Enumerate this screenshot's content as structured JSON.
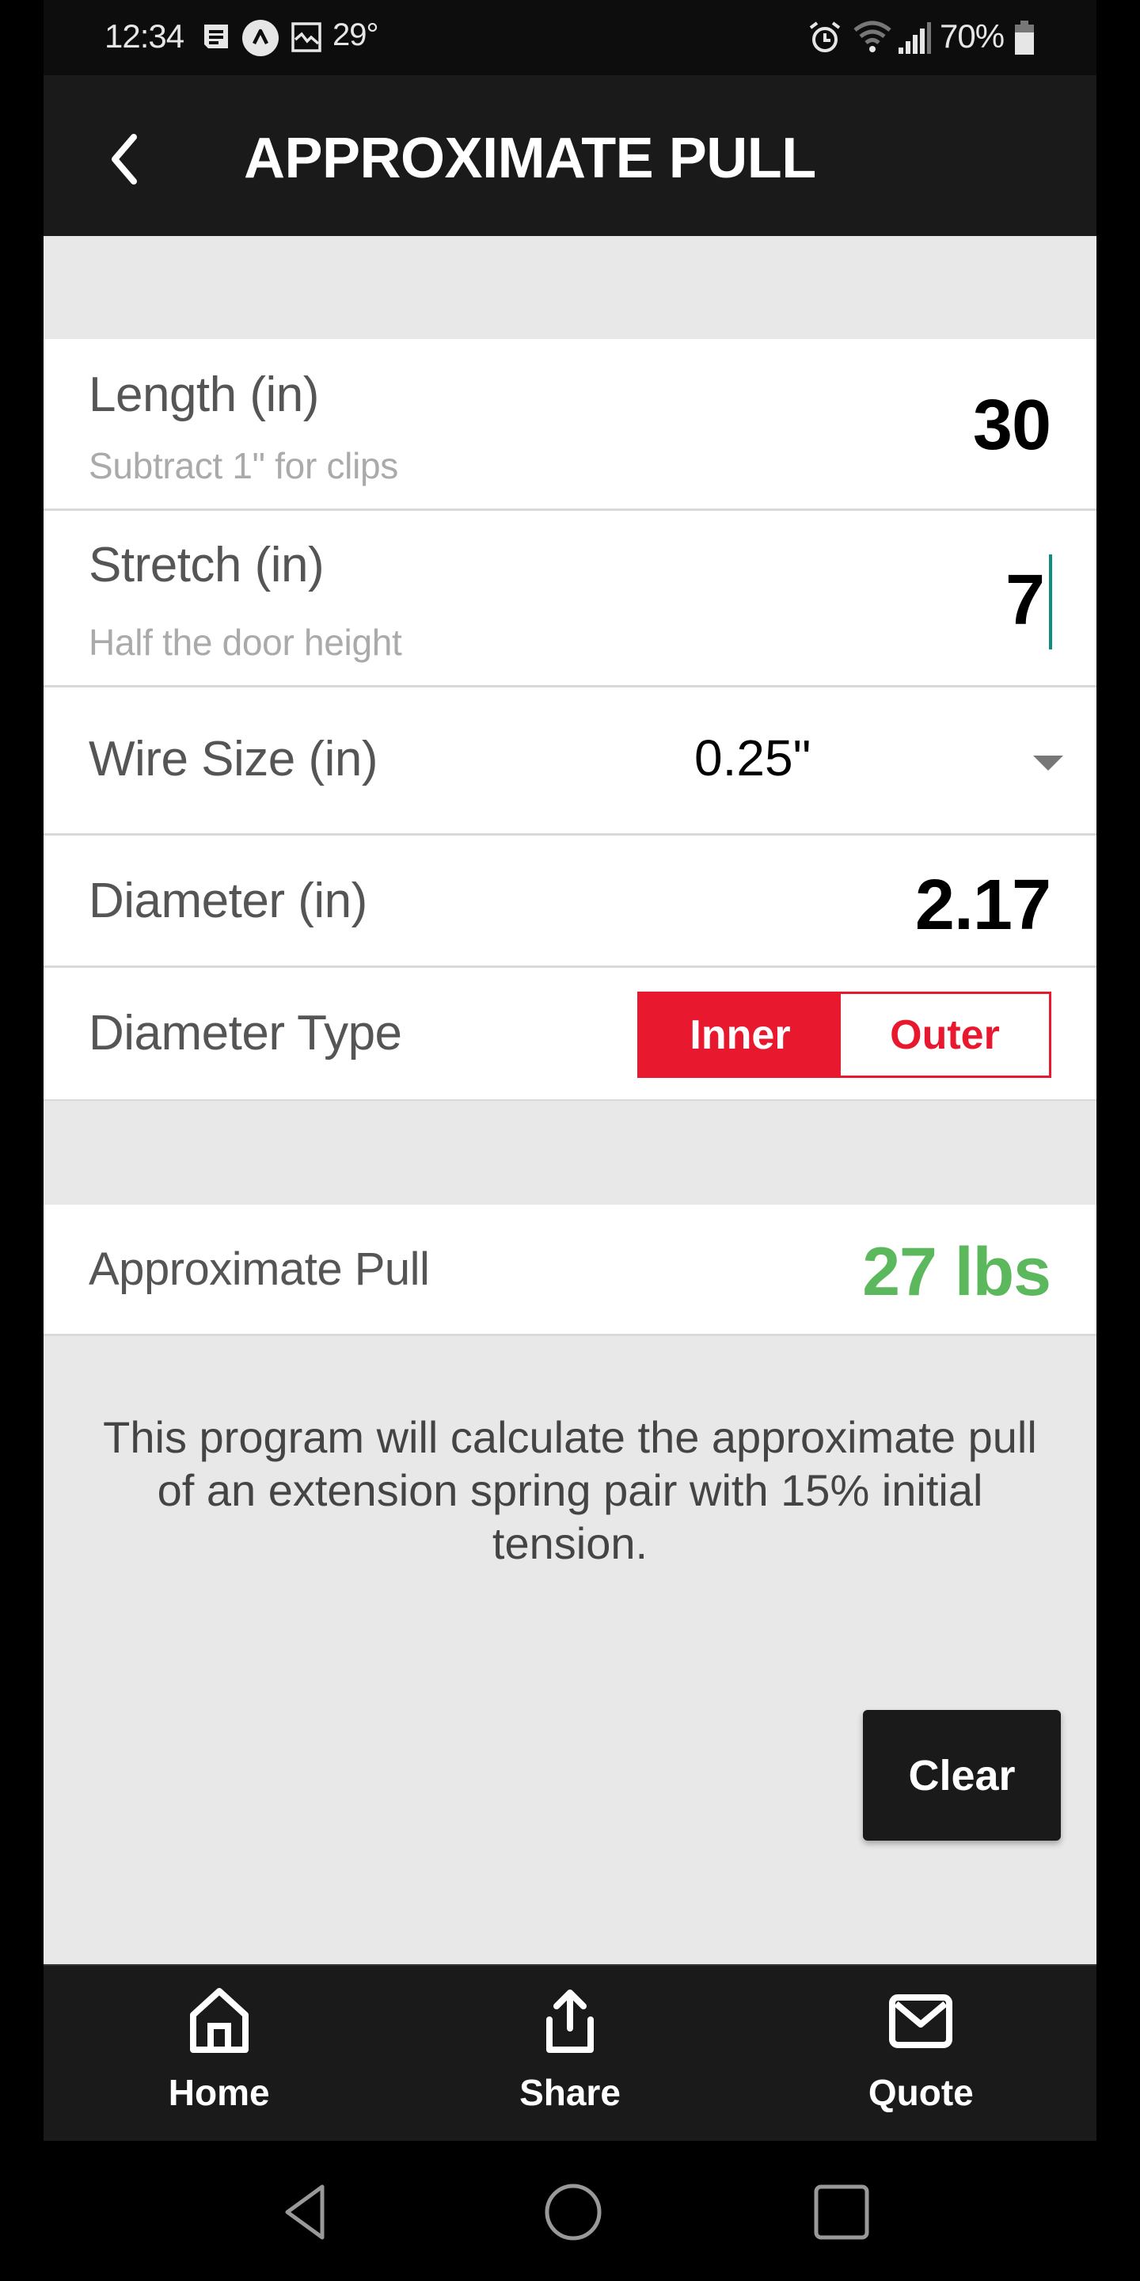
{
  "status_bar": {
    "time": "12:34",
    "temperature": "29°",
    "battery_percent": "70%",
    "left_icons": [
      "message-icon",
      "navigation-app-icon",
      "gallery-icon"
    ],
    "right_icons": [
      "alarm-icon",
      "wifi-icon",
      "signal-icon",
      "battery-icon"
    ]
  },
  "header": {
    "title": "APPROXIMATE PULL",
    "back_icon": "chevron-left-icon"
  },
  "form": {
    "length": {
      "label": "Length (in)",
      "hint": "Subtract 1\" for clips",
      "value": "30"
    },
    "stretch": {
      "label": "Stretch (in)",
      "hint": "Half the door height",
      "value": "7"
    },
    "wire_size": {
      "label": "Wire Size (in)",
      "selected": "0.25\""
    },
    "diameter": {
      "label": "Diameter (in)",
      "value": "2.17"
    },
    "diameter_type": {
      "label": "Diameter Type",
      "options": [
        {
          "label": "Inner",
          "selected": true
        },
        {
          "label": "Outer",
          "selected": false
        }
      ]
    }
  },
  "result": {
    "label": "Approximate Pull",
    "value": "27 lbs",
    "color": "#5cb85c"
  },
  "description": "This program will calculate the approximate pull of an extension spring pair with 15% initial tension.",
  "clear_button": "Clear",
  "bottom_nav": [
    {
      "label": "Home",
      "icon": "home-icon"
    },
    {
      "label": "Share",
      "icon": "share-icon"
    },
    {
      "label": "Quote",
      "icon": "mail-icon"
    }
  ],
  "accent_color": "#e8192f",
  "system_nav": [
    "back",
    "home",
    "recents"
  ]
}
